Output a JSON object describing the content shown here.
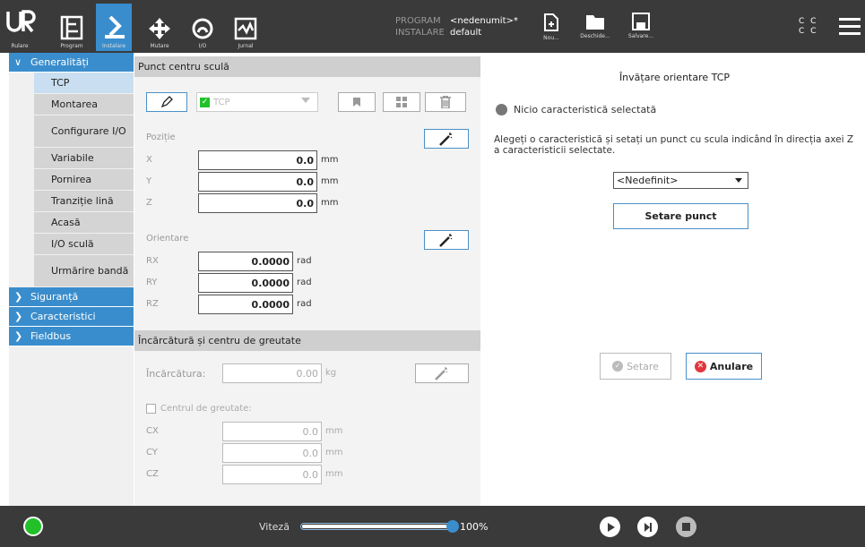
{
  "nav": {
    "run": "Rulare",
    "program": "Program",
    "install": "Instalare",
    "move": "Mutare",
    "io": "I/O",
    "log": "Jurnal"
  },
  "program": {
    "program_key": "PROGRAM",
    "program_val": "<nedenumit>*",
    "install_key": "INSTALARE",
    "install_val": "default"
  },
  "file": {
    "new": "Nou...",
    "open": "Deschide...",
    "save": "Salvare..."
  },
  "status_cc": [
    "C  C",
    "C  C"
  ],
  "sidebar": {
    "general": "Generalități",
    "items": [
      {
        "label": "TCP"
      },
      {
        "label": "Montarea"
      },
      {
        "label": "Configurare I/O"
      },
      {
        "label": "Variabile"
      },
      {
        "label": "Pornirea"
      },
      {
        "label": "Tranziție lină"
      },
      {
        "label": "Acasă"
      },
      {
        "label": "I/O sculă"
      },
      {
        "label": "Urmărire bandă"
      }
    ],
    "groups": [
      "Siguranță",
      "Caracteristici",
      "Fieldbus"
    ]
  },
  "tcp": {
    "section": "Punct centru sculă",
    "select_value": "TCP",
    "position": "Poziție",
    "orientation": "Orientare",
    "x": {
      "label": "X",
      "value": "0.0",
      "unit": "mm"
    },
    "y": {
      "label": "Y",
      "value": "0.0",
      "unit": "mm"
    },
    "z": {
      "label": "Z",
      "value": "0.0",
      "unit": "mm"
    },
    "rx": {
      "label": "RX",
      "value": "0.0000",
      "unit": "rad"
    },
    "ry": {
      "label": "RY",
      "value": "0.0000",
      "unit": "rad"
    },
    "rz": {
      "label": "RZ",
      "value": "0.0000",
      "unit": "rad"
    }
  },
  "payload": {
    "section": "Încărcătură și centru de greutate",
    "label": "Încărcătura:",
    "value": "0.00",
    "unit": "kg",
    "cog": "Centrul de greutate:",
    "cx": {
      "label": "CX",
      "value": "0.0",
      "unit": "mm"
    },
    "cy": {
      "label": "CY",
      "value": "0.0",
      "unit": "mm"
    },
    "cz": {
      "label": "CZ",
      "value": "0.0",
      "unit": "mm"
    }
  },
  "teach": {
    "title": "Învățare orientare TCP",
    "status": "Nicio caracteristică selectată",
    "instructions": "Alegeți o caracteristică și setați un punct cu scula indicând în direcția axei Z a caracteristicii selectate.",
    "dropdown": "<Nedefinit>",
    "set_point": "Setare punct",
    "set": "Setare",
    "cancel": "Anulare"
  },
  "footer": {
    "speed_label": "Viteză",
    "speed_pct": "100%",
    "speed_value": 100
  },
  "colors": {
    "header": "#3a3a3a",
    "accent": "#3a8dcc",
    "go": "#22c12a",
    "cancel_red": "#e0363d"
  }
}
